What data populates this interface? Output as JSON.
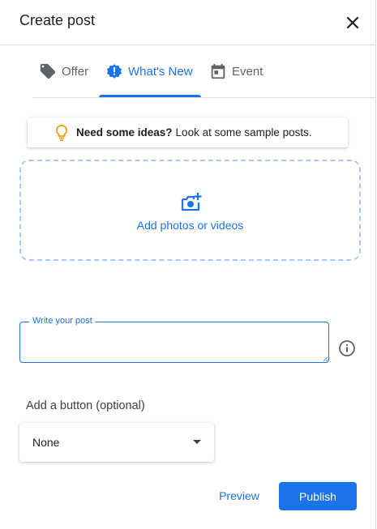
{
  "dialog": {
    "title": "Create post"
  },
  "tabs": [
    {
      "label": "Offer",
      "icon": "tag-icon"
    },
    {
      "label": "What's New",
      "icon": "new-badge-icon",
      "active": true
    },
    {
      "label": "Event",
      "icon": "calendar-icon"
    }
  ],
  "ideas": {
    "bold": "Need some ideas?",
    "text": "Look at some sample posts."
  },
  "upload": {
    "label": "Add photos or videos"
  },
  "post": {
    "label": "Write your post",
    "value": ""
  },
  "button_select": {
    "label": "Add a button (optional)",
    "value": "None"
  },
  "actions": {
    "preview": "Preview",
    "publish": "Publish"
  },
  "colors": {
    "accent": "#1a73e8",
    "bulb": "#f29900",
    "muted": "#5f6368"
  }
}
